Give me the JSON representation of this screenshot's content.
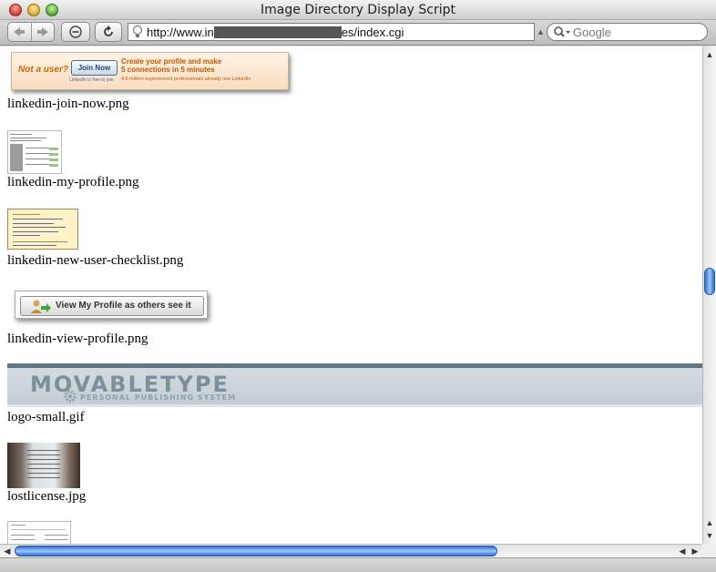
{
  "window": {
    "title": "Image Directory Display Script"
  },
  "toolbar": {
    "back_icon": "back-arrow-icon",
    "forward_icon": "forward-arrow-icon",
    "url_prefix": "http://www.in",
    "url_suffix": "es/index.cgi",
    "search_placeholder": "Google"
  },
  "ads": {
    "join": {
      "not_user": "Not a user?",
      "button": "Join Now",
      "free": "LinkedIn is free to join",
      "line1": "Create your profile and make",
      "line2": "5 connections in 5 minutes",
      "line3": "4.8 million experienced professionals already use LinkedIn"
    },
    "view_profile": {
      "button": "View My Profile as others see it"
    },
    "movabletype": {
      "logo": "MOVABLETYPE",
      "sub": "PERSONAL PUBLISHING SYSTEM"
    }
  },
  "files": [
    {
      "name": "linkedin-join-now.png"
    },
    {
      "name": "linkedin-my-profile.png"
    },
    {
      "name": "linkedin-new-user-checklist.png"
    },
    {
      "name": "linkedin-view-profile.png"
    },
    {
      "name": "logo-small.gif"
    },
    {
      "name": "lostlicense.jpg"
    }
  ],
  "colors": {
    "accent": "#2f6fd2",
    "banner": "#5e7685"
  }
}
